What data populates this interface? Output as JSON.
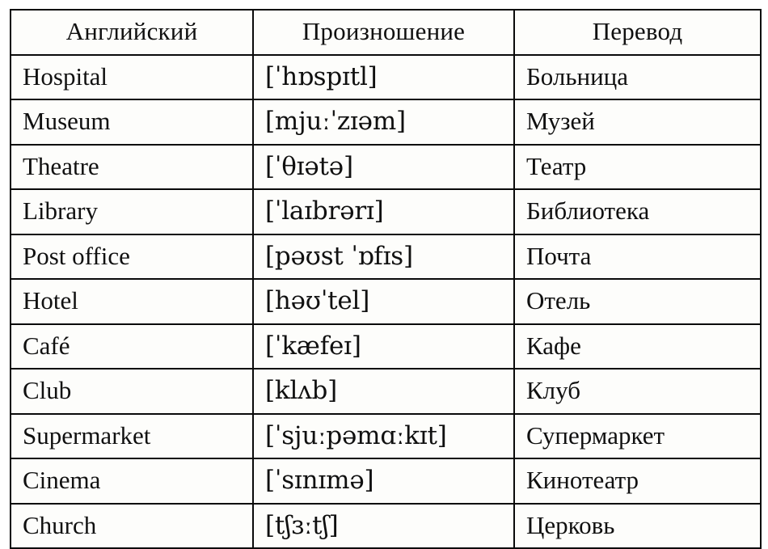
{
  "table": {
    "title": "English vocabulary table",
    "columns": [
      {
        "key": "english",
        "label": "Английский"
      },
      {
        "key": "pronunciation",
        "label": "Произношение"
      },
      {
        "key": "translation",
        "label": "Перевод"
      }
    ],
    "rows": [
      {
        "english": "Hospital",
        "pronunciation": "[ˈhɒspɪtl]",
        "translation": "Больница"
      },
      {
        "english": "Museum",
        "pronunciation": "[mjuːˈzɪəm]",
        "translation": "Музей"
      },
      {
        "english": "Theatre",
        "pronunciation": "[ˈθɪətə]",
        "translation": "Театр"
      },
      {
        "english": "Library",
        "pronunciation": "[ˈlaɪbrərɪ]",
        "translation": "Библиотека"
      },
      {
        "english": "Post office",
        "pronunciation": "[pəʊst ˈɒfɪs]",
        "translation": "Почта"
      },
      {
        "english": "Hotel",
        "pronunciation": "[həʊˈtel]",
        "translation": "Отель"
      },
      {
        "english": "Café",
        "pronunciation": "[ˈkæfeɪ]",
        "translation": "Кафе"
      },
      {
        "english": "Club",
        "pronunciation": "[klʌb]",
        "translation": "Клуб"
      },
      {
        "english": "Supermarket",
        "pronunciation": "[ˈsjuːpəmɑːkɪt]",
        "translation": "Супермаркет"
      },
      {
        "english": "Cinema",
        "pronunciation": "[ˈsɪnɪmə]",
        "translation": "Кинотеатр"
      },
      {
        "english": "Church",
        "pronunciation": "[tʃɜːtʃ]",
        "translation": "Церковь"
      }
    ]
  },
  "colors": {
    "border": "#0a0a0a",
    "text": "#101010",
    "background": "#ffffff",
    "cell_background": "#fdfdfb"
  }
}
